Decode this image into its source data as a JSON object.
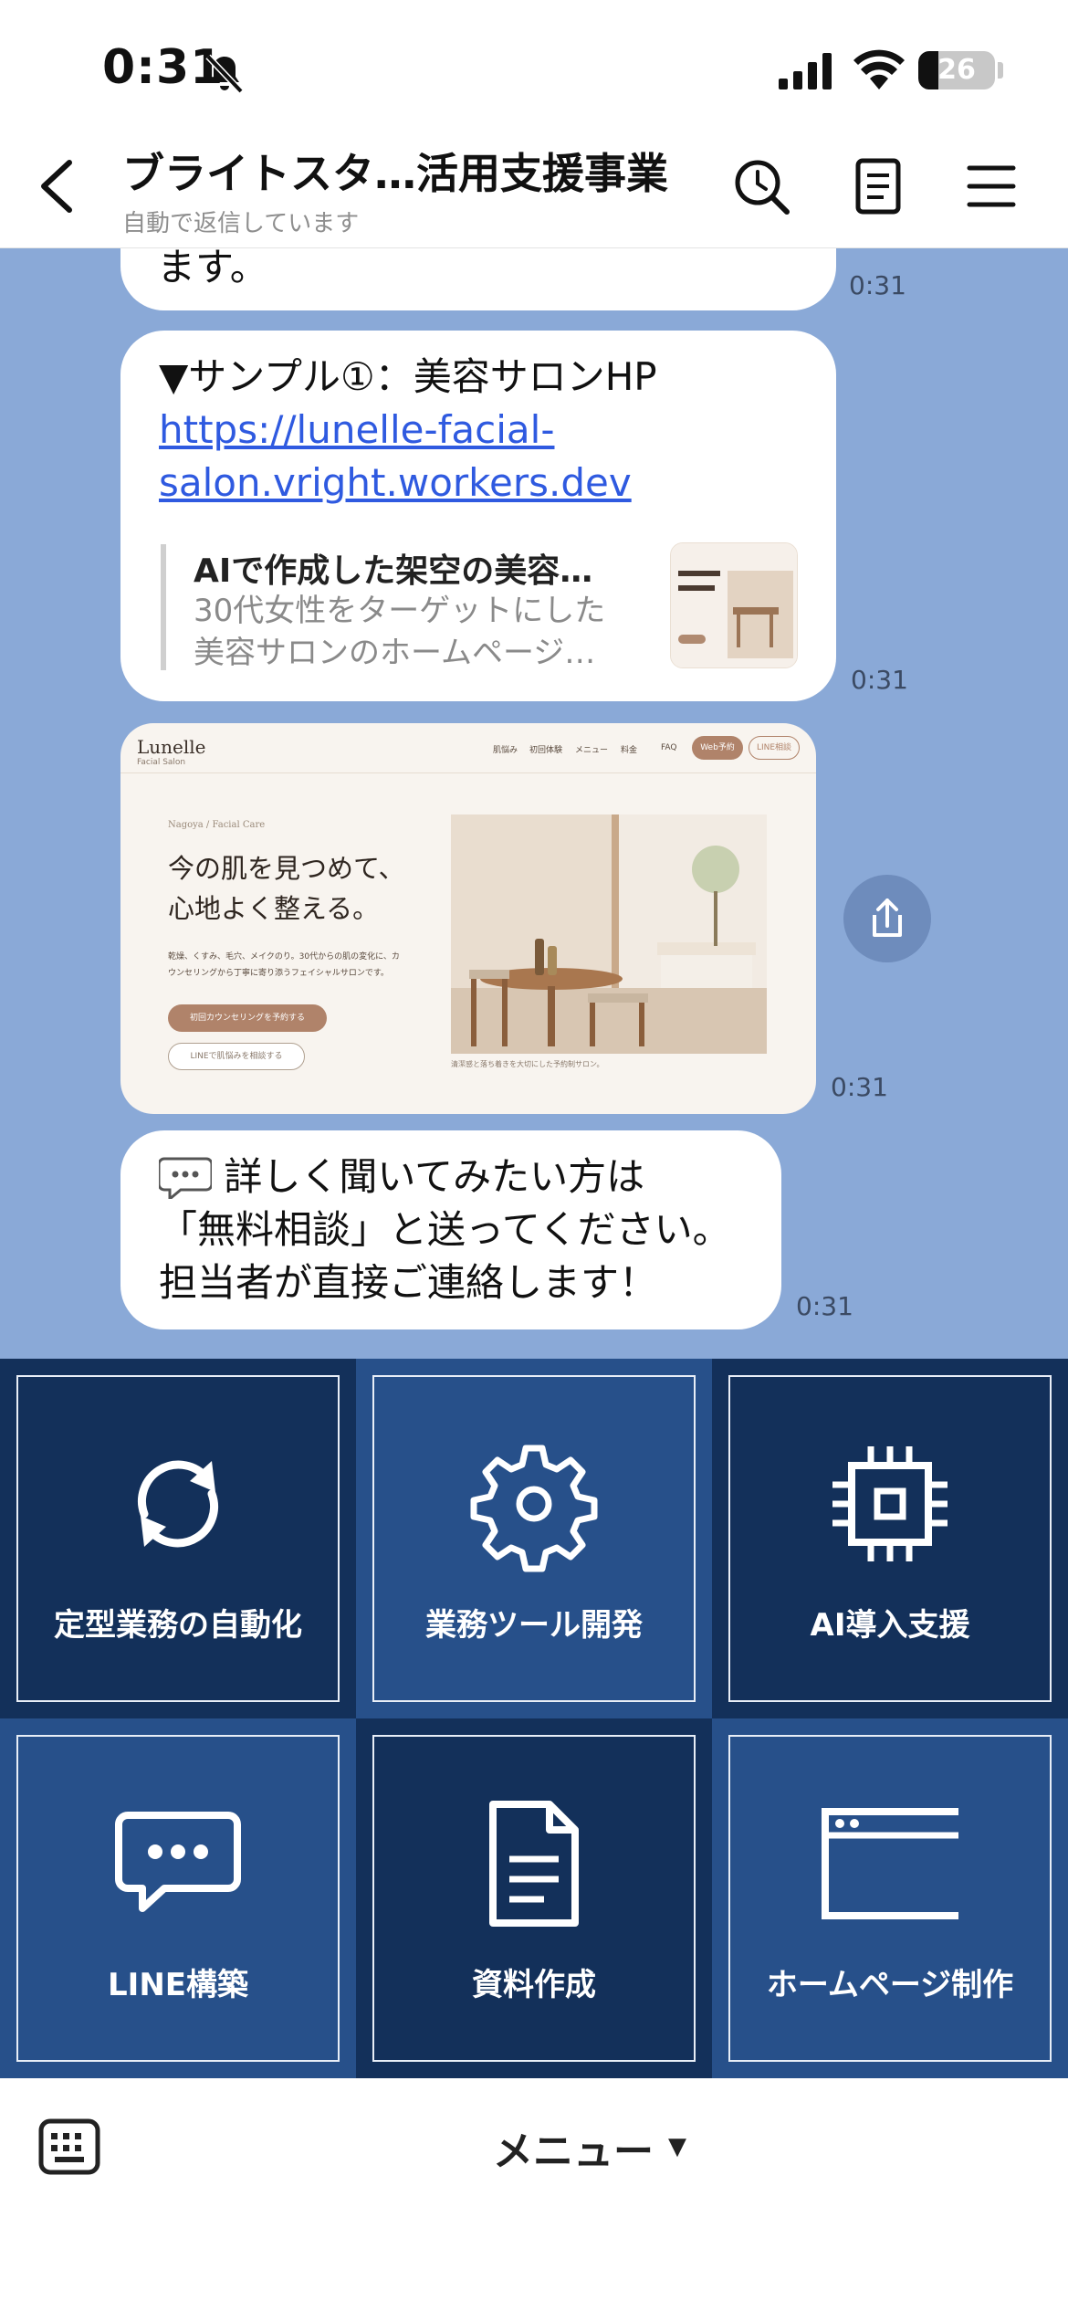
{
  "status_bar": {
    "time": "0:31",
    "battery": "26",
    "battery_level": 0.26
  },
  "header": {
    "title": "ブライトスタ…活用支援事業",
    "subtitle": "自動で返信しています"
  },
  "messages": [
    {
      "text": "ます。",
      "time": "0:31"
    },
    {
      "text": "▼サンプル①：美容サロンHP",
      "link_line1": "https://lunelle-facial-",
      "link_line2": "salon.vright.workers.dev",
      "preview_title": "AIで作成した架空の美容…",
      "preview_desc_line1": "30代女性をターゲットにした",
      "preview_desc_line2": "美容サロンのホームページ…",
      "time": "0:31"
    },
    {
      "image": {
        "brand": "Lunelle",
        "brand_sub": "Facial Salon",
        "nav": [
          "肌悩み",
          "初回体験",
          "メニュー",
          "料金",
          "FAQ"
        ],
        "btn_web": "Web予約",
        "btn_line": "LINE相談",
        "eyebrow": "Nagoya / Facial Care",
        "headline_line1": "今の肌を見つめて、",
        "headline_line2": "心地よく整える。",
        "body_line1": "乾燥、くすみ、毛穴、メイクのり。30代からの肌の変化に、カ",
        "body_line2": "ウンセリングから丁寧に寄り添うフェイシャルサロンです。",
        "cta_primary": "初回カウンセリングを予約する",
        "cta_secondary": "LINEで肌悩みを相談する",
        "caption": "清潔感と落ち着きを大切にした予約制サロン。"
      },
      "time": "0:31"
    },
    {
      "line1": "詳しく聞いてみたい方は",
      "line2": "「無料相談」と送ってください。",
      "line3": "担当者が直接ご連絡します！",
      "time": "0:31"
    }
  ],
  "rich_menu": [
    {
      "label": "定型業務の自動化",
      "icon": "refresh-icon",
      "bg": "#13305a"
    },
    {
      "label": "業務ツール開発",
      "icon": "gear-icon",
      "bg": "#27508a"
    },
    {
      "label": "AI導入支援",
      "icon": "chip-icon",
      "bg": "#13305a"
    },
    {
      "label": "LINE構築",
      "icon": "chat-bubble-icon",
      "bg": "#27508a"
    },
    {
      "label": "資料作成",
      "icon": "document-icon",
      "bg": "#13305a"
    },
    {
      "label": "ホームページ制作",
      "icon": "browser-window-icon",
      "bg": "#27508a"
    }
  ],
  "bottom_bar": {
    "menu_label": "メニュー",
    "caret": "▼"
  },
  "colors": {
    "chat_bg": "#8aa9d7",
    "link": "#2f5ae0",
    "menu_dark": "#13305a",
    "menu_light": "#27508a"
  }
}
